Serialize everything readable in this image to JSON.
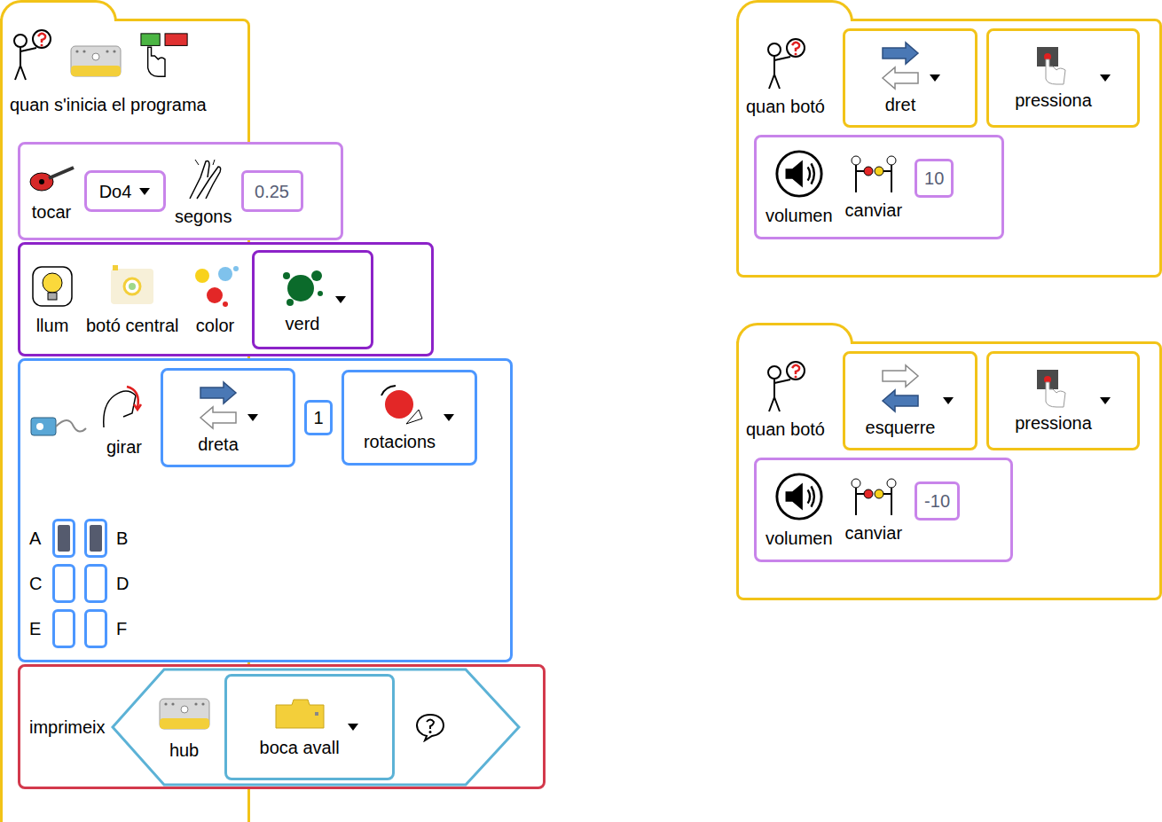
{
  "scripts": [
    {
      "kind": "start",
      "color": "#f2c318",
      "hat": {
        "label": "quan s'inicia el programa"
      },
      "blocks": [
        {
          "kind": "play-note",
          "color": "#c884ea",
          "label": "tocar",
          "note": "Do4",
          "unit": "segons",
          "value": "0.25"
        },
        {
          "kind": "light",
          "color": "#8c22c8",
          "label": "llum",
          "target": "botó central",
          "colorLabel": "color",
          "swatch": {
            "label": "verd",
            "color": "#0b6b2b"
          }
        },
        {
          "kind": "motor",
          "color": "#4c97ff",
          "label": "girar",
          "direction": "dreta",
          "side": "right",
          "value": "1",
          "unit": "rotacions",
          "ports": [
            {
              "label": "A",
              "selected": true
            },
            {
              "label": "B",
              "selected": true
            },
            {
              "label": "C",
              "selected": false
            },
            {
              "label": "D",
              "selected": false
            },
            {
              "label": "E",
              "selected": false
            },
            {
              "label": "F",
              "selected": false
            }
          ]
        },
        {
          "kind": "print",
          "color": "#d3394c",
          "label": "imprimeix",
          "sensor": "hub",
          "sensorColor": "#5cb2d6",
          "orientation": "boca avall"
        }
      ]
    },
    {
      "kind": "button",
      "color": "#f2c318",
      "hat": {
        "label": "quan botó",
        "button": "dret",
        "side": "right",
        "action": "pressiona"
      },
      "blocks": [
        {
          "kind": "volume",
          "color": "#c884ea",
          "label": "volumen",
          "action": "canviar",
          "value": "10"
        }
      ]
    },
    {
      "kind": "button",
      "color": "#f2c318",
      "hat": {
        "label": "quan botó",
        "button": "esquerre",
        "side": "left",
        "action": "pressiona"
      },
      "blocks": [
        {
          "kind": "volume",
          "color": "#c884ea",
          "label": "volumen",
          "action": "canviar",
          "value": "-10"
        }
      ]
    }
  ]
}
